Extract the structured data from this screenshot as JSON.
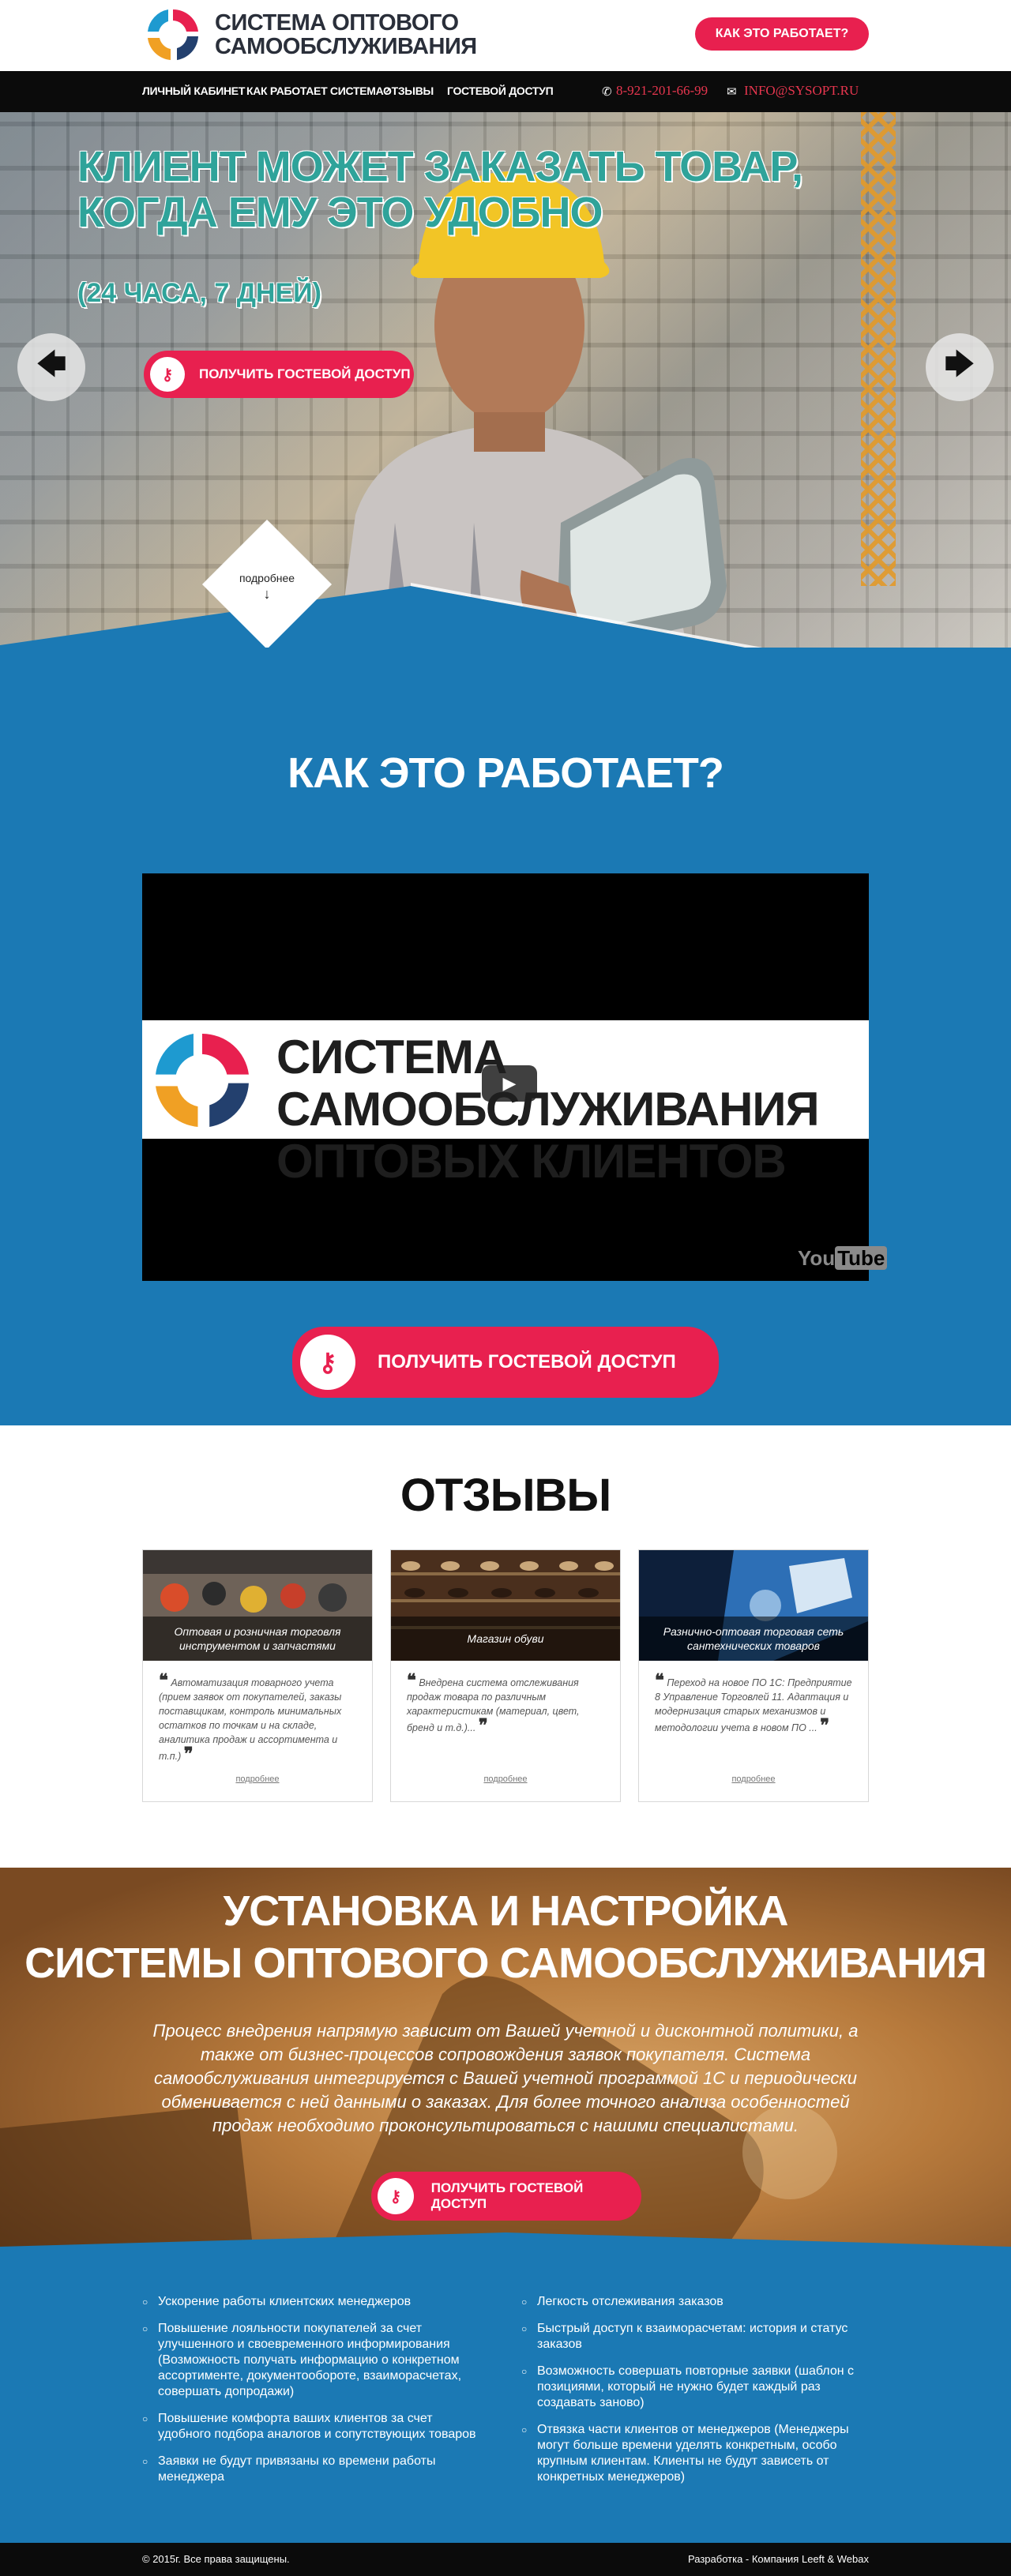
{
  "header": {
    "logo_line1": "СИСТЕМА ОПТОВОГО",
    "logo_line2": "САМООБСЛУЖИВАНИЯ",
    "how_button": "КАК ЭТО РАБОТАЕТ?"
  },
  "nav": {
    "items": [
      "ЛИЧНЫЙ КАБИНЕТ",
      "КАК РАБОТАЕТ СИСТЕМА?",
      "ОТЗЫВЫ",
      "ГОСТЕВОЙ ДОСТУП"
    ],
    "phone": "8-921-201-66-99",
    "email": "INFO@SYSOPT.RU"
  },
  "hero": {
    "title_line1": "КЛИЕНТ МОЖЕТ ЗАКАЗАТЬ ТОВАР,",
    "title_line2": "КОГДА ЕМУ ЭТО УДОБНО",
    "subtitle": "(24 ЧАСА, 7 ДНЕЙ)",
    "cta": "ПОЛУЧИТЬ ГОСТЕВОЙ ДОСТУП",
    "more": "подробнее",
    "more_arrow": "↓",
    "prev": "🡄",
    "next": "🡆"
  },
  "how": {
    "title": "КАК ЭТО РАБОТАЕТ?",
    "video_line1": "СИСТЕМА САМООБСЛУЖИВАНИЯ",
    "video_line2": "ОПТОВЫХ КЛИЕНТОВ",
    "youtube_you": "You",
    "youtube_tube": "Tube",
    "play": "▶",
    "cta": "ПОЛУЧИТЬ ГОСТЕВОЙ ДОСТУП"
  },
  "reviews": {
    "title": "ОТЗЫВЫ",
    "open_quote": "❝",
    "close_quote": "❞",
    "items": [
      {
        "caption": "Оптовая и розничная торговля инструментом и запчастями",
        "text": "Автоматизация товарного учета (прием заявок от покупателей, заказы поставщикам, контроль минимальных остатков по точкам и на складе, аналитика продаж и ассортимента и т.п.)",
        "more": "подробнее"
      },
      {
        "caption": "Магазин обуви",
        "text": "Внедрена система отслеживания продаж товара по различным характеристикам (материал, цвет, бренд и т.д.)...",
        "more": "подробнее"
      },
      {
        "caption": "Разнично-оптовая торговая сеть сантехнических товаров",
        "text": "Переход на новое ПО 1С: Предприятие 8 Управление Торговлей 11. Адаптация и модернизация старых механизмов и методологии учета в новом ПО ...",
        "more": "подробнее"
      }
    ]
  },
  "setup": {
    "title_line1": "УСТАНОВКА И НАСТРОЙКА",
    "title_line2": "СИСТЕМЫ ОПТОВОГО САМООБСЛУЖИВАНИЯ",
    "text": "Процесс внедрения напрямую зависит от Вашей учетной и дисконтной политики, а также от бизнес-процессов сопровождения заявок покупателя. Система самообслуживания интегрируется с Вашей учетной программой 1С и периодически обменивается с ней данными о заказах. Для более точного анализа особенностей продаж необходимо проконсультироваться с нашими специалистами.",
    "cta": "ПОЛУЧИТЬ ГОСТЕВОЙ ДОСТУП"
  },
  "benefits": {
    "left": [
      "Ускорение работы клиентских менеджеров",
      "Повышение лояльности покупателей за счет улучшенного и своевременного информирования (Возможность получать информацию о конкретном ассортименте, документообороте, взаиморасчетах, совершать допродажи)",
      "Повышение комфорта ваших клиентов за счет удобного подбора аналогов и сопутствующих товаров",
      "Заявки не будут привязаны ко времени работы менеджера"
    ],
    "right": [
      "Легкость отслеживания заказов",
      "Быстрый доступ к взаиморасчетам: история и статус заказов",
      "Возможность совершать повторные заявки (шаблон с позициями, который не нужно будет каждый раз создавать заново)",
      "Отвязка части клиентов от менеджеров (Менеджеры могут больше времени уделять конкретным, особо крупным клиентам. Клиенты не будут зависеть от конкретных менеджеров)"
    ]
  },
  "footer": {
    "copyright": "© 2015г. Все права защищены.",
    "dev": "Разработка - Компания Leeft & Webax"
  },
  "colors": {
    "accent_red": "#e8204f",
    "brand_blue": "#1b79b4",
    "hero_teal": "#2fa39a",
    "nav_bg": "#0b0b0b"
  }
}
